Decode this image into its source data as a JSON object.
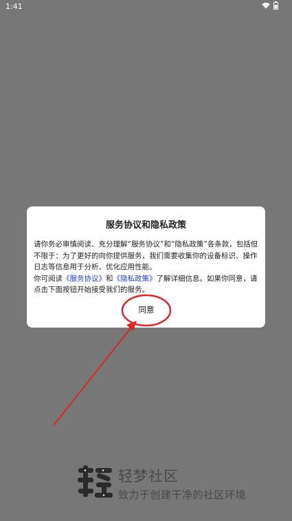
{
  "status_bar": {
    "time": "1:41"
  },
  "dialog": {
    "title": "服务协议和隐私政策",
    "paragraph1": "请你务必审慎阅读、充分理解“服务协议”和“隐私政策”各条款，包括但不限于：为了更好的向你提供服务，我们需要收集你的设备标识、操作日志等信息用于分析、优化应用性能。",
    "p2_prefix": "你可阅读",
    "service_link": "《服务协议》",
    "p2_and": "和",
    "privacy_link": "《隐私政策》",
    "p2_suffix": "了解详细信息。如果你同意，请点击下面按钮开始接受我们的服务。",
    "agree_label": "同意"
  },
  "splash": {
    "app_name": "轻梦社区",
    "slogan": "致力于创建干净的社区环境"
  },
  "annotation": {
    "color": "#e0262b"
  }
}
